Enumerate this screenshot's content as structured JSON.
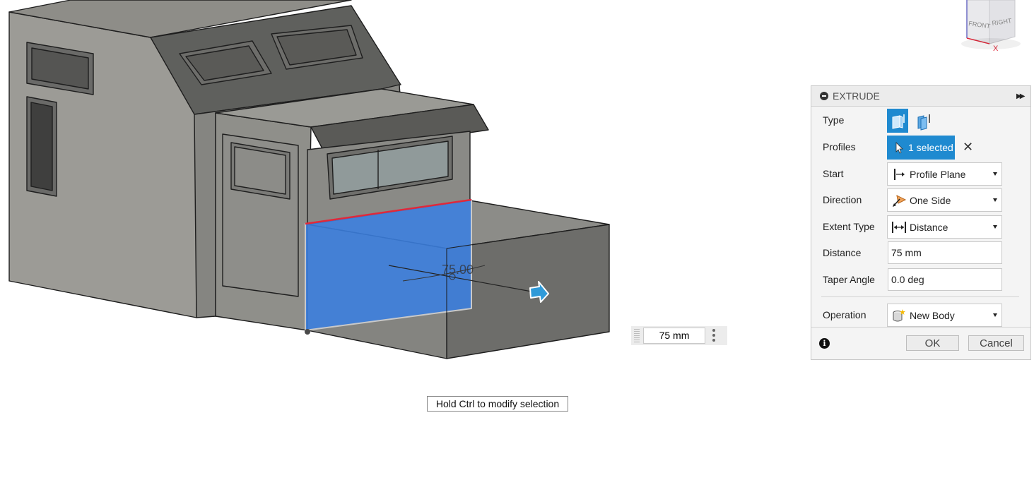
{
  "viewport": {
    "dimension_value": "75.00",
    "viewcube": {
      "front_label": "FRONT",
      "right_label": "RIGHT",
      "axis_label": "X"
    }
  },
  "panel": {
    "title": "EXTRUDE",
    "rows": {
      "type": {
        "label": "Type"
      },
      "profiles": {
        "label": "Profiles",
        "value": "1 selected"
      },
      "start": {
        "label": "Start",
        "value": "Profile Plane",
        "icon": "profile-plane-icon"
      },
      "direction": {
        "label": "Direction",
        "value": "One Side",
        "icon": "one-side-icon"
      },
      "extent_type": {
        "label": "Extent Type",
        "value": "Distance",
        "icon": "distance-icon"
      },
      "distance": {
        "label": "Distance",
        "value": "75 mm"
      },
      "taper_angle": {
        "label": "Taper Angle",
        "value": "0.0 deg"
      },
      "operation": {
        "label": "Operation",
        "value": "New Body",
        "icon": "new-body-icon"
      }
    },
    "ok_label": "OK",
    "cancel_label": "Cancel",
    "accent_color": "#1f8ad0"
  },
  "distance_widget": {
    "value": "75 mm"
  },
  "hint": "Hold Ctrl to modify selection"
}
